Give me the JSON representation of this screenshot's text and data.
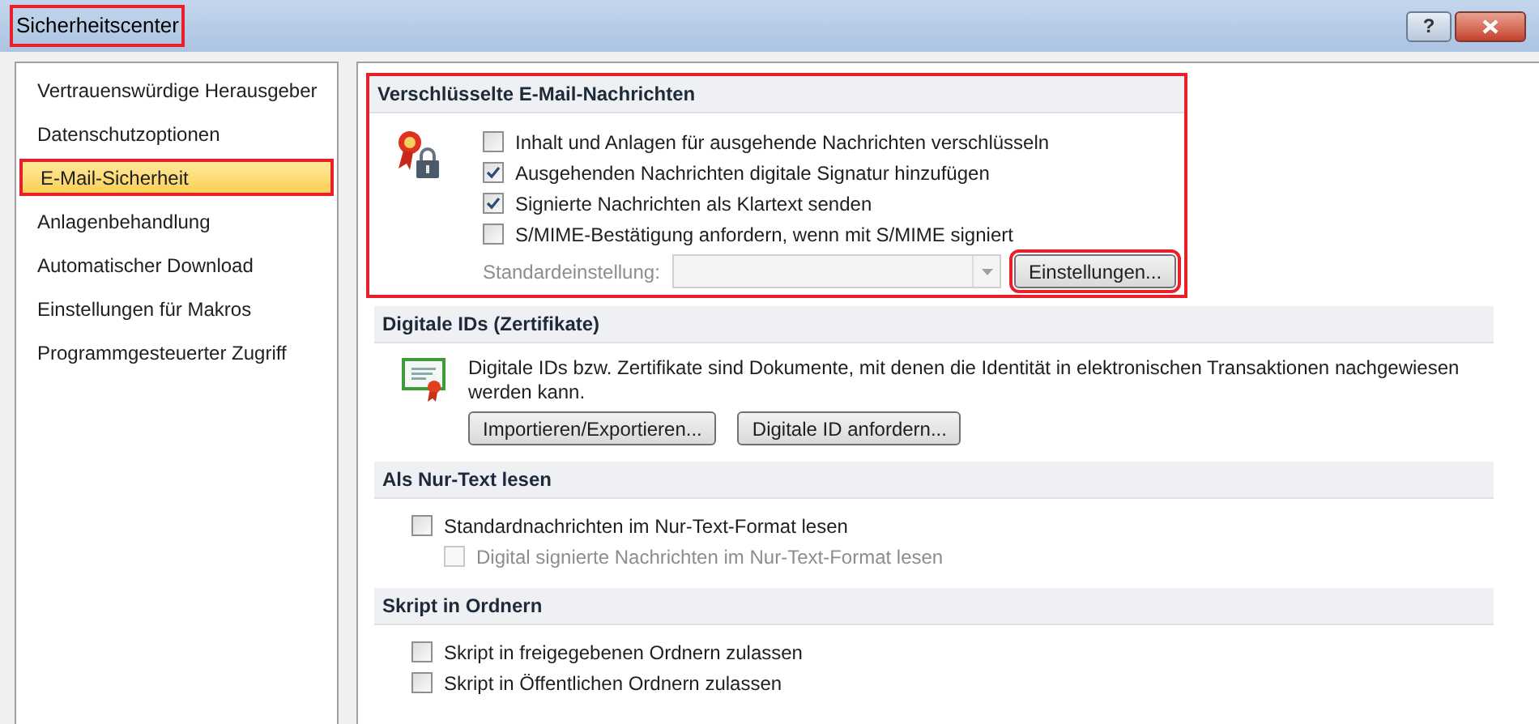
{
  "window": {
    "title": "Sicherheitscenter",
    "highlighted": true,
    "help_button": "?"
  },
  "sidebar": {
    "items": [
      {
        "label": "Vertrauenswürdige Herausgeber",
        "selected": false,
        "highlighted": false
      },
      {
        "label": "Datenschutzoptionen",
        "selected": false,
        "highlighted": false
      },
      {
        "label": "E-Mail-Sicherheit",
        "selected": true,
        "highlighted": true
      },
      {
        "label": "Anlagenbehandlung",
        "selected": false,
        "highlighted": false
      },
      {
        "label": "Automatischer Download",
        "selected": false,
        "highlighted": false
      },
      {
        "label": "Einstellungen für Makros",
        "selected": false,
        "highlighted": false
      },
      {
        "label": "Programmgesteuerter Zugriff",
        "selected": false,
        "highlighted": false
      }
    ]
  },
  "sections": [
    {
      "kind": "encryption",
      "title": "Verschlüsselte E-Mail-Nachrichten",
      "highlighted": true,
      "checkboxes": [
        {
          "label": "Inhalt und Anlagen für ausgehende Nachrichten verschlüsseln",
          "checked": false,
          "disabled": false
        },
        {
          "label": "Ausgehenden Nachrichten digitale Signatur hinzufügen",
          "checked": true,
          "disabled": false
        },
        {
          "label": "Signierte Nachrichten als Klartext senden",
          "checked": true,
          "disabled": false
        },
        {
          "label": "S/MIME-Bestätigung anfordern, wenn mit S/MIME signiert",
          "checked": false,
          "disabled": false
        }
      ],
      "default_setting": {
        "label": "Standardeinstellung:",
        "disabled": true
      },
      "button": {
        "label": "Einstellungen...",
        "highlighted": true
      }
    },
    {
      "kind": "ids",
      "title": "Digitale IDs (Zertifikate)",
      "highlighted": false,
      "description": "Digitale IDs bzw. Zertifikate sind Dokumente, mit denen die Identität in elektronischen Transaktionen nachgewiesen werden kann.",
      "buttons": [
        "Importieren/Exportieren...",
        "Digitale ID anfordern..."
      ]
    },
    {
      "kind": "checks",
      "title": "Als Nur-Text lesen",
      "highlighted": false,
      "checkboxes": [
        {
          "label": "Standardnachrichten im Nur-Text-Format lesen",
          "checked": false,
          "disabled": false,
          "children": [
            {
              "label": "Digital signierte Nachrichten im Nur-Text-Format lesen",
              "checked": false,
              "disabled": true
            }
          ]
        }
      ]
    },
    {
      "kind": "checks",
      "title": "Skript in Ordnern",
      "highlighted": false,
      "checkboxes": [
        {
          "label": "Skript in freigegebenen Ordnern zulassen",
          "checked": false,
          "disabled": false
        },
        {
          "label": "Skript in Öffentlichen Ordnern zulassen",
          "checked": false,
          "disabled": false
        }
      ]
    }
  ]
}
